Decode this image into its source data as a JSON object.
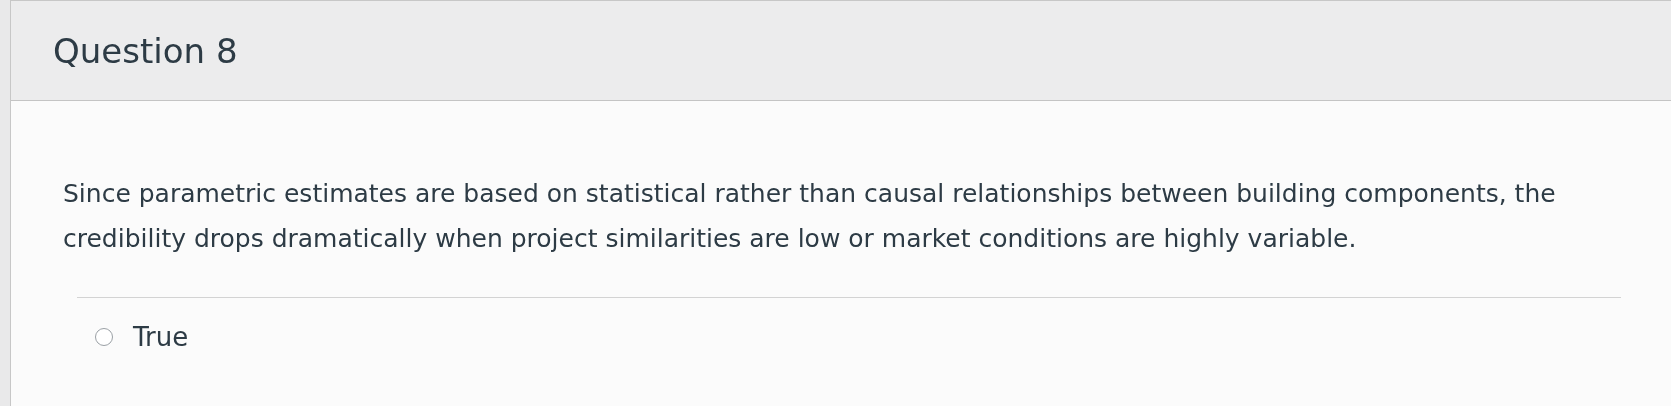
{
  "question": {
    "title": "Question 8",
    "text": "Since parametric estimates are based on statistical rather than causal relationships between building components, the credibility drops dramatically when project similarities are low or market conditions are highly variable.",
    "answers": [
      {
        "label": "True",
        "selected": false
      }
    ]
  }
}
